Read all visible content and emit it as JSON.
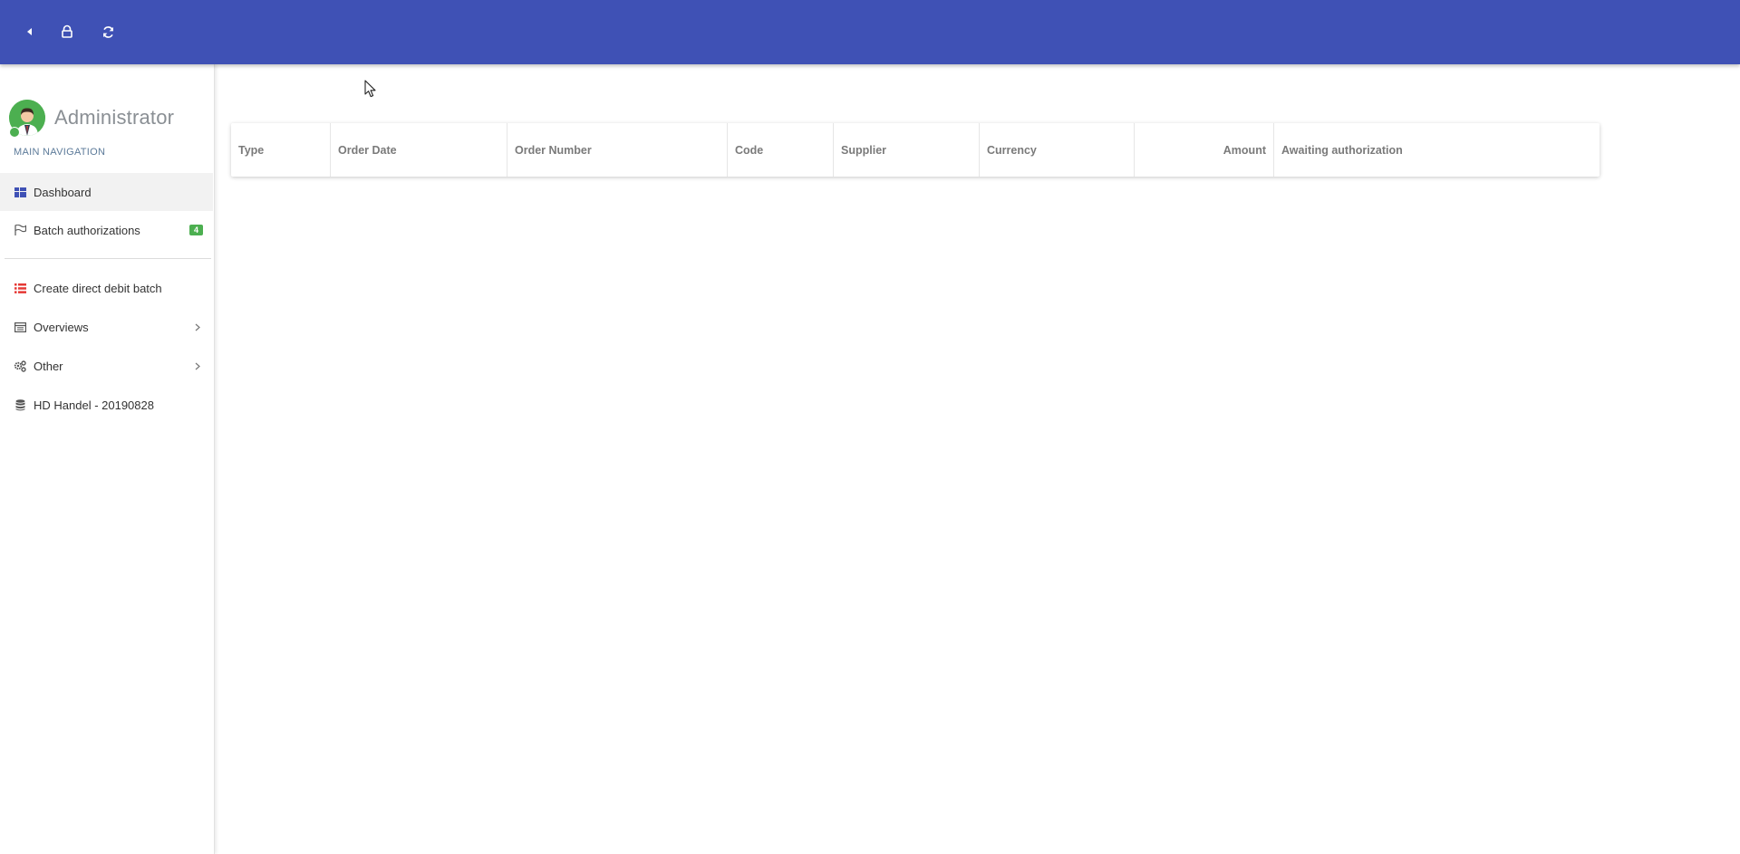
{
  "topbar": {
    "background_color": "#3f51b5",
    "buttons": [
      {
        "name": "collapse-sidebar-button",
        "icon": "caret-left-icon"
      },
      {
        "name": "lock-button",
        "icon": "lock-icon"
      },
      {
        "name": "refresh-button",
        "icon": "refresh-icon"
      }
    ]
  },
  "sidebar": {
    "user": {
      "name": "Administrator",
      "status": "online",
      "status_color": "#4caf50"
    },
    "nav_header": "MAIN NAVIGATION",
    "items": [
      {
        "label": "Dashboard",
        "icon": "dashboard-icon",
        "active": true
      },
      {
        "label": "Batch authorizations",
        "icon": "flag-icon",
        "badge": "4",
        "badge_color": "#4caf50"
      },
      {
        "label": "Create direct debit batch",
        "icon": "list-icon",
        "icon_color": "#e53935"
      },
      {
        "label": "Overviews",
        "icon": "table-list-icon",
        "has_submenu": true
      },
      {
        "label": "Other",
        "icon": "gears-icon",
        "has_submenu": true
      },
      {
        "label": "HD Handel - 20190828",
        "icon": "database-icon"
      }
    ]
  },
  "table": {
    "columns": [
      {
        "label": "Type"
      },
      {
        "label": "Order Date"
      },
      {
        "label": "Order Number"
      },
      {
        "label": "Code"
      },
      {
        "label": "Supplier"
      },
      {
        "label": "Currency"
      },
      {
        "label": "Amount",
        "align": "right"
      },
      {
        "label": "Awaiting authorization"
      }
    ],
    "rows": []
  }
}
